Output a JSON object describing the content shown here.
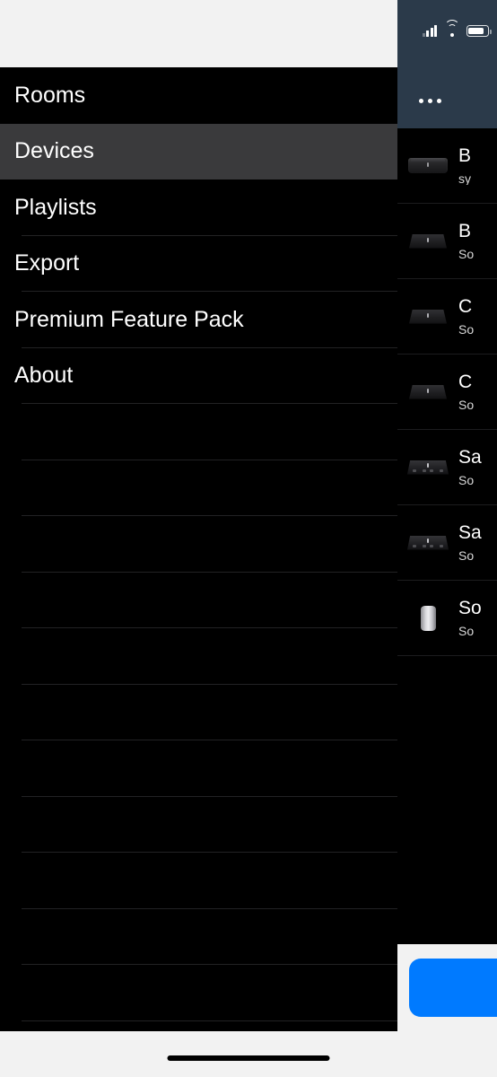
{
  "status_bar": {
    "signal_icon": "cellular-signal-icon",
    "wifi_icon": "wifi-icon",
    "battery_icon": "battery-icon",
    "overflow_label": "..."
  },
  "drawer": {
    "items": [
      {
        "label": "Rooms",
        "selected": false,
        "separator": false
      },
      {
        "label": "Devices",
        "selected": true,
        "separator": false
      },
      {
        "label": "Playlists",
        "selected": false,
        "separator": true
      },
      {
        "label": "Export",
        "selected": false,
        "separator": true
      },
      {
        "label": "Premium Feature Pack",
        "selected": false,
        "separator": true
      },
      {
        "label": "About",
        "selected": false,
        "separator": true
      }
    ],
    "filler_row_count": 11
  },
  "device_list": {
    "rows": [
      {
        "name": "B",
        "subtitle": "sy",
        "thumb": "speaker-box-icon"
      },
      {
        "name": "B",
        "subtitle": "So",
        "thumb": "speaker-trapezoid-icon"
      },
      {
        "name": "C",
        "subtitle": "So",
        "thumb": "speaker-trapezoid-icon"
      },
      {
        "name": "C",
        "subtitle": "So",
        "thumb": "speaker-trapezoid-icon"
      },
      {
        "name": "Sa",
        "subtitle": "So",
        "thumb": "speaker-amp-icon"
      },
      {
        "name": "Sa",
        "subtitle": "So",
        "thumb": "speaker-amp-icon"
      },
      {
        "name": "So",
        "subtitle": "So",
        "thumb": "speaker-cylinder-icon"
      }
    ]
  },
  "action_bar": {
    "primary_button_label": ""
  },
  "colors": {
    "accent_blue": "#007aff",
    "status_bar_bg": "#2b3a4a",
    "drawer_bg": "#000000",
    "selected_row_bg": "#3a3a3c",
    "panel_light_bg": "#f2f2f2"
  }
}
